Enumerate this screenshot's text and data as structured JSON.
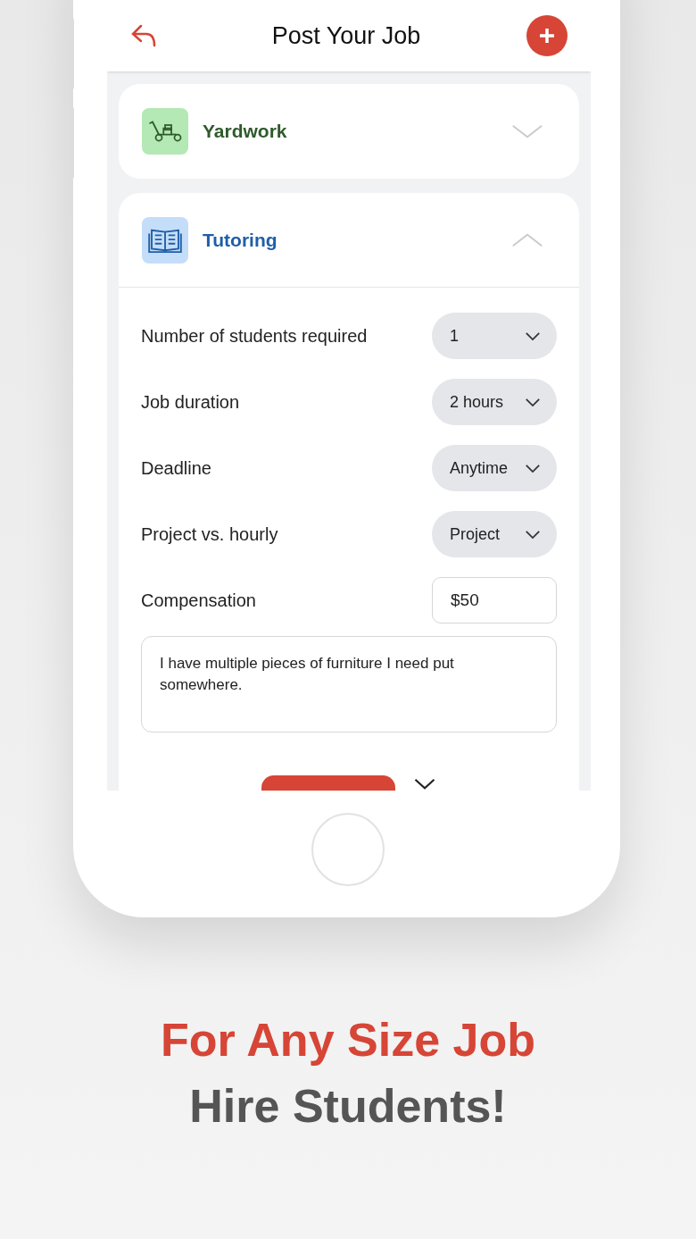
{
  "header": {
    "title": "Post Your Job"
  },
  "categories": [
    {
      "label": "Yardwork",
      "kind": "yardwork",
      "expanded": false,
      "color": "#2f5a2c"
    },
    {
      "label": "Tutoring",
      "kind": "tutoring",
      "expanded": true,
      "color": "#1f5fa8"
    }
  ],
  "fields": [
    {
      "label": "Number of students required",
      "kind": "dropdown",
      "value": "1"
    },
    {
      "label": "Job duration",
      "kind": "dropdown",
      "value": "2 hours"
    },
    {
      "label": "Deadline",
      "kind": "dropdown",
      "value": "Anytime"
    },
    {
      "label": "Project vs. hourly",
      "kind": "dropdown",
      "value": "Project"
    },
    {
      "label": "Compensation",
      "kind": "input",
      "value": "$50"
    }
  ],
  "description": {
    "value": "I have multiple pieces of furniture I need put somewhere."
  },
  "tagline": {
    "line_1": "For Any Size Job",
    "line_2": "Hire Students!"
  }
}
